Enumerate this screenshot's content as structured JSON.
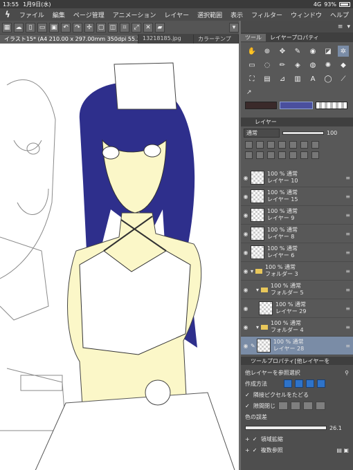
{
  "status": {
    "time": "13:55",
    "date": "1月9日(水)",
    "network": "4G",
    "battery": "93%"
  },
  "menu": [
    "ファイル",
    "編集",
    "ページ管理",
    "アニメーション",
    "レイヤー",
    "選択範囲",
    "表示",
    "フィルター",
    "ウィンドウ",
    "ヘルプ"
  ],
  "tabs": [
    "イラスト15* (A4 210.00 x 297.00mm 350dpi 55.3%)",
    "13218185.jpg",
    "カラーテンプ"
  ],
  "panel_tabs": {
    "tool": "ツール",
    "layer_property": "レイヤープロパティ"
  },
  "layers_panel": {
    "title": "レイヤー",
    "blend_mode": "通常",
    "opacity": "100",
    "items": [
      {
        "line1": "100 % 通常",
        "line2": "レイヤー 10",
        "type": "layer",
        "selected": false
      },
      {
        "line1": "100 % 通常",
        "line2": "レイヤー 15",
        "type": "layer",
        "selected": false
      },
      {
        "line1": "100 % 通常",
        "line2": "レイヤー 9",
        "type": "layer",
        "selected": false
      },
      {
        "line1": "100 % 通常",
        "line2": "レイヤー 8",
        "type": "layer",
        "selected": false
      },
      {
        "line1": "100 % 通常",
        "line2": "レイヤー 6",
        "type": "layer",
        "selected": false
      },
      {
        "line1": "100 % 通常",
        "line2": "フォルダー 3",
        "type": "folder",
        "selected": false
      },
      {
        "line1": "100 % 通常",
        "line2": "フォルダー 5",
        "type": "folder",
        "selected": false
      },
      {
        "line1": "100 % 通常",
        "line2": "レイヤー 29",
        "type": "layer",
        "selected": false
      },
      {
        "line1": "100 % 通常",
        "line2": "フォルダー 4",
        "type": "folder",
        "selected": false
      },
      {
        "line1": "100 % 通常",
        "line2": "レイヤー 28",
        "type": "layer",
        "selected": true
      }
    ]
  },
  "tool_property": {
    "header": "ツールプロパティ[他レイヤーを",
    "subtitle": "他レイヤーを参照選択",
    "mode_label": "作成方法",
    "opt_skip_transparent": "隣接ピクセルをたどる",
    "opt_close_gaps": "隙間閉じ",
    "tolerance_label": "色の誤差",
    "tolerance_value": "26.1",
    "expand_label": "領域拡縮",
    "multi_ref_label": "複数参照"
  },
  "colors": {
    "main": "#3a2a2a",
    "sub": "#4a4f9e",
    "canvas_bg": "#ffffff",
    "hair": "#2e2f8c",
    "skin": "#fbf7c8"
  }
}
